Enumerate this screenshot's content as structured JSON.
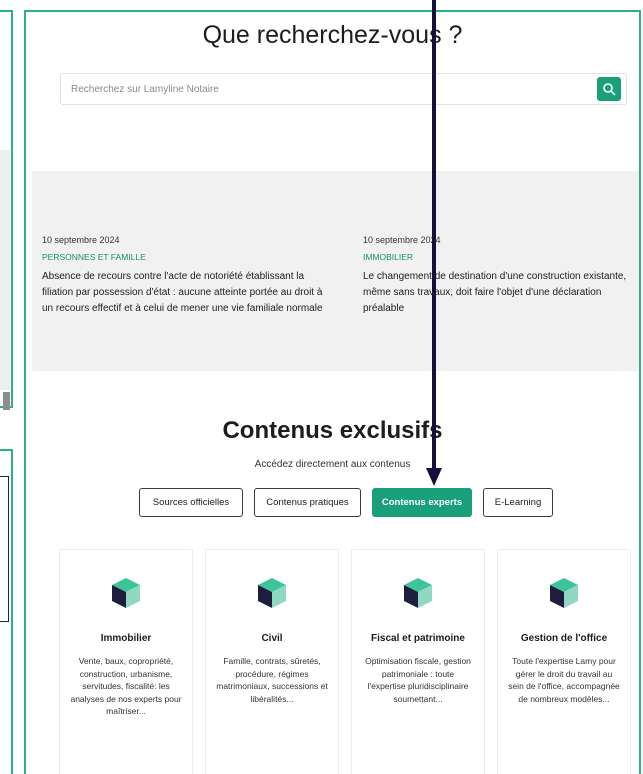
{
  "search": {
    "title": "Que recherchez-vous ?",
    "placeholder": "Recherchez sur Lamyline Notaire",
    "button_icon": "search-icon"
  },
  "news": [
    {
      "date": "10 septembre 2024",
      "category": "PERSONNES ET FAMILLE",
      "title": "Absence de recours contre l'acte de notoriété établissant la filiation par possession d'état : aucune atteinte portée au droit à un recours effectif et à celui de mener une vie familiale normale"
    },
    {
      "date": "10 septembre 2024",
      "category": "IMMOBILIER",
      "title": "Le changement de destination d'une construction existante, même sans travaux, doit faire l'objet d'une déclaration préalable"
    }
  ],
  "exclusive": {
    "title": "Contenus exclusifs",
    "subtitle": "Accédez directement aux contenus",
    "tabs": [
      "Sources officielles",
      "Contenus pratiques",
      "Contenus experts",
      "E-Learning"
    ],
    "active_tab": "Contenus experts"
  },
  "cards": [
    {
      "title": "Immobilier",
      "description": "Vente, baux, copropriété, construction, urbanisme, servitudes, fiscalité: les analyses de nos experts pour maîtriser...",
      "icon": "cube-icon"
    },
    {
      "title": "Civil",
      "description": "Famille, contrats, sûretés, procédure, régimes matrimoniaux, successions et libéralités...",
      "icon": "cube-icon"
    },
    {
      "title": "Fiscal et patrimoine",
      "description": "Optimisation fiscale, gestion patrimoniale : toute l'expertise pluridisciplinaire soumettant...",
      "icon": "cube-icon"
    },
    {
      "title": "Gestion de l'office",
      "description": "Toute l'expertise Lamy pour gérer le droit du travail au sein de l'office, accompagnée de nombreux modèles...",
      "icon": "cube-icon"
    }
  ],
  "colors": {
    "accent": "#19a07a",
    "frame": "#2bb089",
    "cube_dark": "#1f1d3d",
    "cube_light": "#3ec49a"
  }
}
